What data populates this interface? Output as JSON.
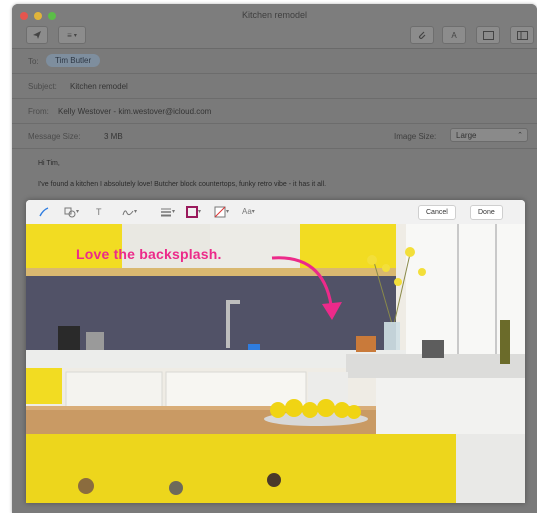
{
  "window": {
    "title": "Kitchen remodel",
    "toolbar": {
      "send_icon": "paper-plane-icon",
      "header_menu_label": "≡",
      "attach_icon": "paperclip-icon",
      "format_label": "A",
      "photo_browser_icon": "photo-icon",
      "sidebar_icon": "sidebar-icon"
    }
  },
  "mail": {
    "to_label": "To:",
    "to_recipient": "Tim Butler",
    "subject_label": "Subject:",
    "subject_value": "Kitchen remodel",
    "from_label": "From:",
    "from_value": "Kelly Westover - kim.westover@icloud.com",
    "message_size_label": "Message Size:",
    "message_size_value": "3 MB",
    "image_size_label": "Image Size:",
    "image_size_value": "Large",
    "body_greeting": "Hi Tim,",
    "body_line": "I've found a kitchen I absolutely love! Butcher block countertops, funky retro vibe - it has it all."
  },
  "markup": {
    "cancel_label": "Cancel",
    "done_label": "Done",
    "text_tool_label": "T",
    "annotation_text": "Love the backsplash.",
    "annotation_color": "#ec2a8a"
  },
  "colors": {
    "accent_pink": "#ec2a8a",
    "cabinet_yellow": "#f2dc22",
    "backsplash": "#4c4e62"
  }
}
